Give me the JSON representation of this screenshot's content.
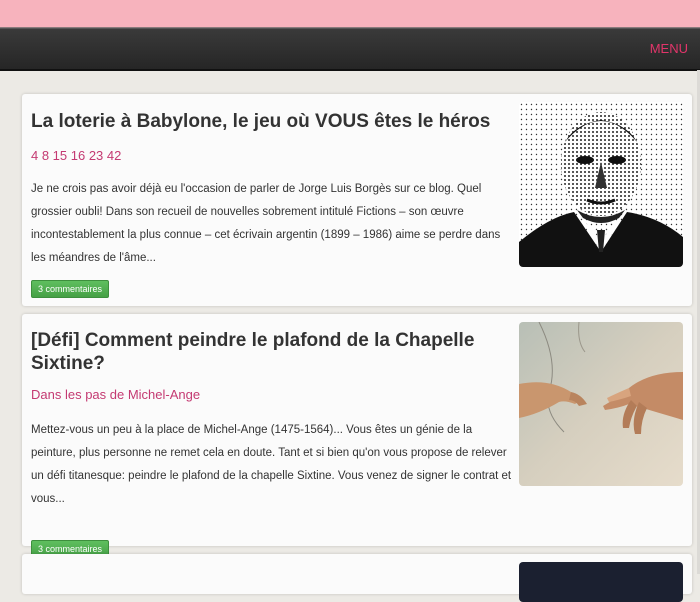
{
  "header": {
    "menu_label": "MENU"
  },
  "posts": [
    {
      "title": "La loterie à Babylone, le jeu où VOUS êtes le héros",
      "subtitle": "4 8 15 16 23 42",
      "excerpt": "Je ne crois pas avoir déjà eu l'occasion de parler de Jorge Luis Borgès sur ce blog. Quel grossier oubli! Dans son recueil de nouvelles sobrement intitulé Fictions – son œuvre incontestablement la plus connue – cet écrivain argentin (1899 – 1986) aime se perdre dans les méandres de l'âme...",
      "comments": "3 commentaires",
      "thumb_icon": "borges-portrait-image"
    },
    {
      "title": "[Défi] Comment peindre le plafond de la Chapelle Sixtine?",
      "subtitle": "Dans les pas de Michel-Ange",
      "excerpt": "Mettez-vous un peu à la place de Michel-Ange (1475-1564)... Vous êtes un génie de la peinture, plus personne ne remet cela en doute. Tant et si bien qu'on vous propose de relever un défi titanesque: peindre le plafond de la chapelle Sixtine. Vous venez de signer le contrat et vous...",
      "comments": "3 commentaires",
      "thumb_icon": "creation-of-adam-image"
    }
  ],
  "colors": {
    "accent": "#c43a72",
    "menu": "#e2356a",
    "top_band": "#f7b3bd",
    "nav": "#2c2c2c",
    "button": "#4caf50"
  }
}
